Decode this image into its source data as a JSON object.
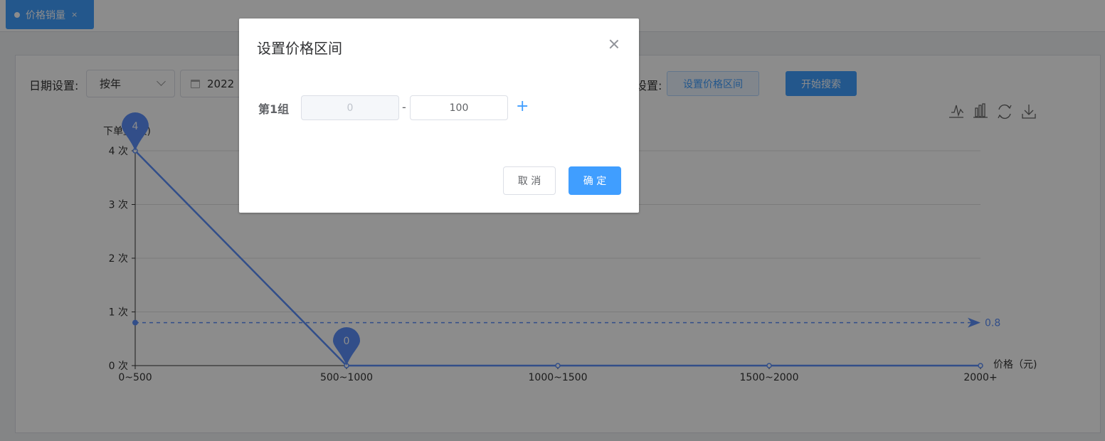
{
  "tabs": [
    {
      "label": "价格销量",
      "close": "×"
    }
  ],
  "filters": {
    "date_label": "日期设置:",
    "date_mode": "按年",
    "date_value": "2022",
    "price_label": "设置:",
    "set_range_button": "设置价格区间",
    "search_button": "开始搜索"
  },
  "toolbox": [
    "line-chart-icon",
    "bar-chart-icon",
    "refresh-icon",
    "download-icon"
  ],
  "chart_data": {
    "type": "line",
    "categories": [
      "0~500",
      "500~1000",
      "1000~1500",
      "1500~2000",
      "2000+"
    ],
    "values": [
      4,
      0,
      0,
      0,
      0
    ],
    "ylabel": "下单量(次)",
    "xlabel": "价格（元)",
    "ylim": [
      0,
      4
    ],
    "yticks": [
      "0 次",
      "1 次",
      "2 次",
      "3 次",
      "4 次"
    ],
    "markpoints": [
      {
        "index": 0,
        "label": "4"
      },
      {
        "index": 1,
        "label": "0"
      }
    ],
    "markline": {
      "value": 0.8,
      "label": "0.8"
    },
    "color": "#5b8ff9",
    "grid": true
  },
  "dialog": {
    "title": "设置价格区间",
    "group_label": "第1组",
    "min_value": "0",
    "separator": "-",
    "max_value": "100",
    "add_label": "+",
    "cancel": "取 消",
    "confirm": "确 定"
  },
  "colors": {
    "primary": "#409eff"
  }
}
